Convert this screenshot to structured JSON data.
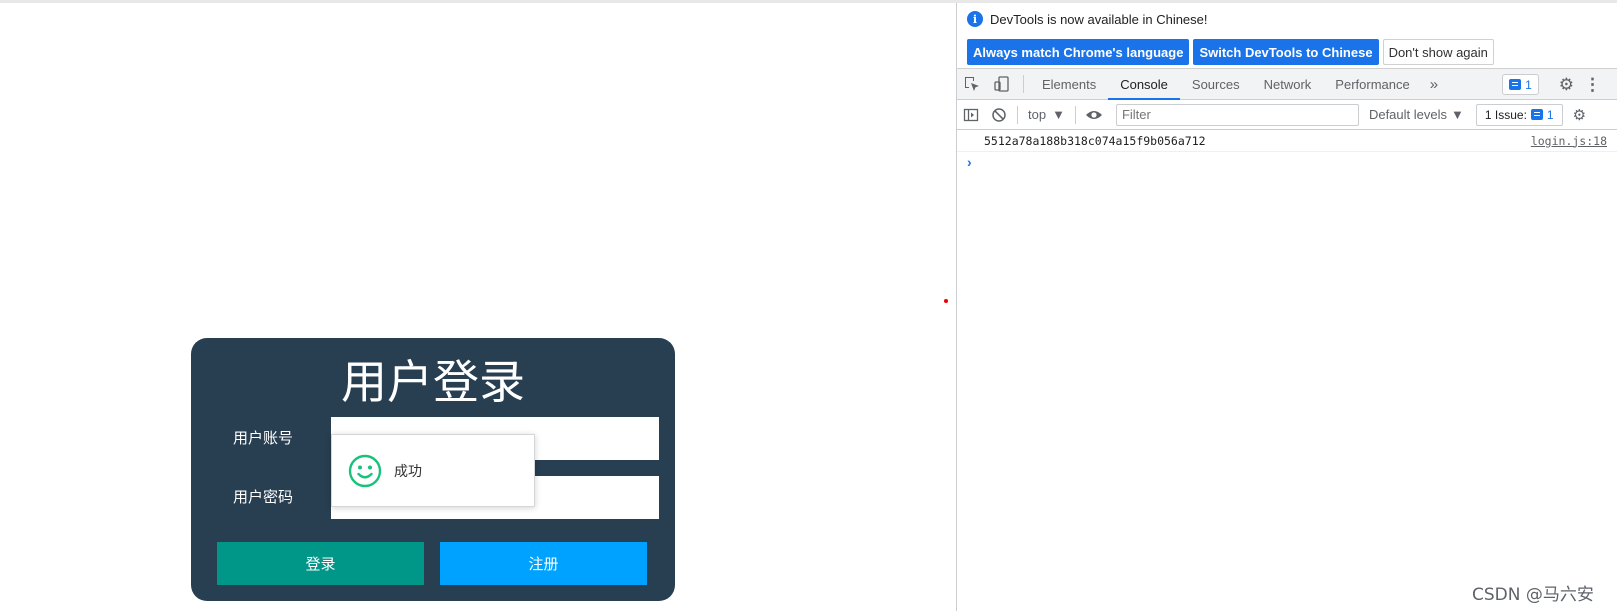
{
  "login": {
    "title": "用户登录",
    "account_label": "用户账号",
    "password_label": "用户密码",
    "account_value": "",
    "password_value": "",
    "login_button": "登录",
    "register_button": "注册"
  },
  "toast": {
    "icon": "smile-icon",
    "message": "成功"
  },
  "colors": {
    "card_bg": "#283e51",
    "login_btn": "#009688",
    "register_btn": "#00a2ff",
    "toast_icon": "#18c27a",
    "devtools_accent": "#1a73e8"
  },
  "devtools": {
    "infobar": {
      "message": "DevTools is now available in Chinese!",
      "match_language": "Always match Chrome's language",
      "switch_chinese": "Switch DevTools to Chinese",
      "dont_show": "Don't show again"
    },
    "tabs": [
      {
        "label": "Elements",
        "active": false
      },
      {
        "label": "Console",
        "active": true
      },
      {
        "label": "Sources",
        "active": false
      },
      {
        "label": "Network",
        "active": false
      },
      {
        "label": "Performance",
        "active": false
      }
    ],
    "more_tabs": "»",
    "messages_count": "1",
    "console_toolbar": {
      "context": "top",
      "filter_placeholder": "Filter",
      "levels": "Default levels",
      "issues_label": "1 Issue:",
      "issues_count": "1"
    },
    "console_log": [
      {
        "text": "5512a78a188b318c074a15f9b056a712",
        "source": "login.js:18"
      }
    ]
  },
  "watermark": "CSDN @马六安"
}
